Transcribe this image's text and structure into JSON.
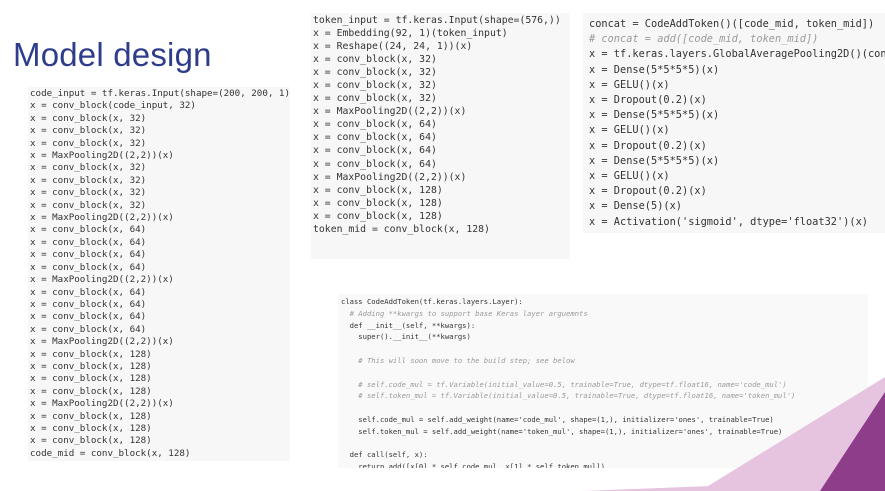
{
  "slide": {
    "title": "Model design",
    "accent_colors": {
      "title": "#2e3c8c",
      "decor_purple": "#8e3d8a",
      "decor_pink": "#e6c4e0",
      "code_background": "#f7f7f7"
    }
  },
  "code_panels": {
    "code_branch": [
      "code_input = tf.keras.Input(shape=(200, 200, 1))",
      "x = conv_block(code_input, 32)",
      "x = conv_block(x, 32)",
      "x = conv_block(x, 32)",
      "x = conv_block(x, 32)",
      "x = MaxPooling2D((2,2))(x)",
      "x = conv_block(x, 32)",
      "x = conv_block(x, 32)",
      "x = conv_block(x, 32)",
      "x = conv_block(x, 32)",
      "x = MaxPooling2D((2,2))(x)",
      "x = conv_block(x, 64)",
      "x = conv_block(x, 64)",
      "x = conv_block(x, 64)",
      "x = conv_block(x, 64)",
      "x = MaxPooling2D((2,2))(x)",
      "x = conv_block(x, 64)",
      "x = conv_block(x, 64)",
      "x = conv_block(x, 64)",
      "x = conv_block(x, 64)",
      "x = MaxPooling2D((2,2))(x)",
      "x = conv_block(x, 128)",
      "x = conv_block(x, 128)",
      "x = conv_block(x, 128)",
      "x = conv_block(x, 128)",
      "x = MaxPooling2D((2,2))(x)",
      "x = conv_block(x, 128)",
      "x = conv_block(x, 128)",
      "x = conv_block(x, 128)",
      "code_mid = conv_block(x, 128)"
    ],
    "token_branch": [
      "token_input = tf.keras.Input(shape=(576,))",
      "x = Embedding(92, 1)(token_input)",
      "x = Reshape((24, 24, 1))(x)",
      "x = conv_block(x, 32)",
      "x = conv_block(x, 32)",
      "x = conv_block(x, 32)",
      "x = conv_block(x, 32)",
      "x = MaxPooling2D((2,2))(x)",
      "x = conv_block(x, 64)",
      "x = conv_block(x, 64)",
      "x = conv_block(x, 64)",
      "x = conv_block(x, 64)",
      "x = MaxPooling2D((2,2))(x)",
      "x = conv_block(x, 128)",
      "x = conv_block(x, 128)",
      "x = conv_block(x, 128)",
      "token_mid = conv_block(x, 128)"
    ],
    "head": [
      "concat = CodeAddToken()([code_mid, token_mid])",
      "# concat = add([code_mid, token_mid])",
      "x = tf.keras.layers.GlobalAveragePooling2D()(con",
      "x = Dense(5*5*5*5)(x)",
      "x = GELU()(x)",
      "x = Dropout(0.2)(x)",
      "x = Dense(5*5*5*5)(x)",
      "x = GELU()(x)",
      "x = Dropout(0.2)(x)",
      "x = Dense(5*5*5*5)(x)",
      "x = GELU()(x)",
      "x = Dropout(0.2)(x)",
      "x = Dense(5)(x)",
      "x = Activation('sigmoid', dtype='float32')(x)"
    ],
    "layer_class": [
      "class CodeAddToken(tf.keras.layers.Layer):",
      "  # Adding **kwargs to support base Keras layer arguemnts",
      "  def __init__(self, **kwargs):",
      "    super().__init__(**kwargs)",
      "",
      "    # This will soon move to the build step; see below",
      "",
      "    # self.code_mul = tf.Variable(initial_value=0.5, trainable=True, dtype=tf.float16, name='code_mul')",
      "    # self.token_mul = tf.Variable(initial_value=0.5, trainable=True, dtype=tf.float16, name='token_mul')",
      "",
      "    self.code_mul = self.add_weight(name='code_mul', shape=(1,), initializer='ones', trainable=True)",
      "    self.token_mul = self.add_weight(name='token_mul', shape=(1,), initializer='ones', trainable=True)",
      "",
      "  def call(self, x):",
      "    return add([x[0] * self.code_mul, x[1] * self.token_mul])"
    ]
  }
}
